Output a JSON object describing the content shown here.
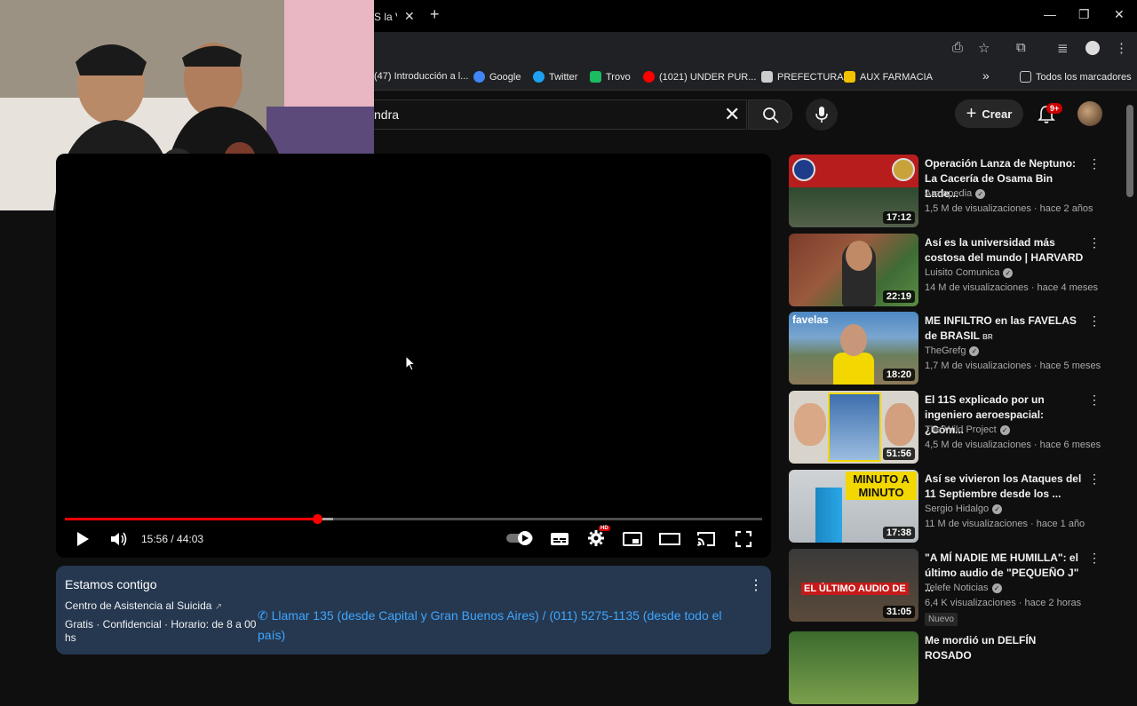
{
  "browser": {
    "tab_title": "S la V",
    "bookmarks": [
      {
        "label": "(47) Introducción a l...",
        "color": "#888888"
      },
      {
        "label": "Google",
        "color": "#4285f4"
      },
      {
        "label": "Twitter",
        "color": "#1da1f2"
      },
      {
        "label": "Trovo",
        "color": "#1cbc62"
      },
      {
        "label": "(1021) UNDER PUR...",
        "color": "#ff0000"
      },
      {
        "label": "PREFECTURA",
        "color": "#cccccc"
      },
      {
        "label": "AUX FARMACIA",
        "color": "#f2c200"
      }
    ],
    "bookmarks_more": "»",
    "all_bookmarks": "Todos los marcadores"
  },
  "header": {
    "search_value": "ndra",
    "create_label": "Crear",
    "notif_badge": "9+"
  },
  "player": {
    "time_current": "15:56",
    "time_total": "44:03",
    "time_display": "15:56 / 44:03",
    "progress": 0.3619,
    "buffered": 0.385,
    "hd_badge": "HD"
  },
  "info_panel": {
    "title": "Estamos contigo",
    "org": "Centro de Asistencia al Suicida",
    "hours": "Gratis · Confidencial · Horario: de 8 a 00 hs",
    "phone": "Llamar 135 (desde Capital y Gran Buenos Aires) / (011) 5275-1135 (desde todo el país)"
  },
  "recommendations": [
    {
      "title": "Operación Lanza de Neptuno: La Cacería de Osama Bin Lade...",
      "channel": "Armapedia",
      "meta": "1,5 M de visualizaciones · hace 2 años",
      "duration": "17:12",
      "colors": [
        "#b81d1d",
        "#2d4a2f"
      ]
    },
    {
      "title": "Así es la universidad más costosa del mundo | HARVARD",
      "channel": "Luisito Comunica",
      "meta": "14 M de visualizaciones · hace 4 meses",
      "duration": "22:19",
      "colors": [
        "#7b3b2a",
        "#3f6b35"
      ]
    },
    {
      "title": "ME INFILTRO en las FAVELAS de BRASIL",
      "title_suffix": "BR",
      "channel": "TheGrefg",
      "meta": "1,7 M de visualizaciones · hace 5 meses",
      "duration": "18:20",
      "thumb_tag": "favelas",
      "colors": [
        "#4e88c4",
        "#f2d700"
      ]
    },
    {
      "title": "El 11S explicado por un ingeniero aeroespacial: ¿Cóm...",
      "channel": "The Wild Project",
      "meta": "4,5 M de visualizaciones · hace 6 meses",
      "duration": "51:56",
      "colors": [
        "#d8d4cc",
        "#3d6fae"
      ]
    },
    {
      "title": "Así se vivieron los Ataques del 11 Septiembre desde los ...",
      "channel": "Sergio Hidalgo",
      "meta": "11 M de visualizaciones · hace 1 año",
      "duration": "17:38",
      "thumb_tag": "MINUTO A MINUTO",
      "colors": [
        "#cfd3d6",
        "#2a9fd8"
      ]
    },
    {
      "title": "\"A MÍ NADIE ME HUMILLA\": el último audio de \"PEQUEÑO J\" ...",
      "channel": "Telefe Noticias",
      "meta": "6,4 K visualizaciones · hace 2 horas",
      "duration": "31:05",
      "badge": "Nuevo",
      "thumb_tag": "EL ÚLTIMO AUDIO DE",
      "colors": [
        "#3a3a3a",
        "#c61a1a"
      ]
    },
    {
      "title": "Me mordió un DELFÍN ROSADO",
      "channel": "",
      "meta": "",
      "duration": "",
      "colors": [
        "#3c6a2e",
        "#7aa04c"
      ]
    }
  ]
}
